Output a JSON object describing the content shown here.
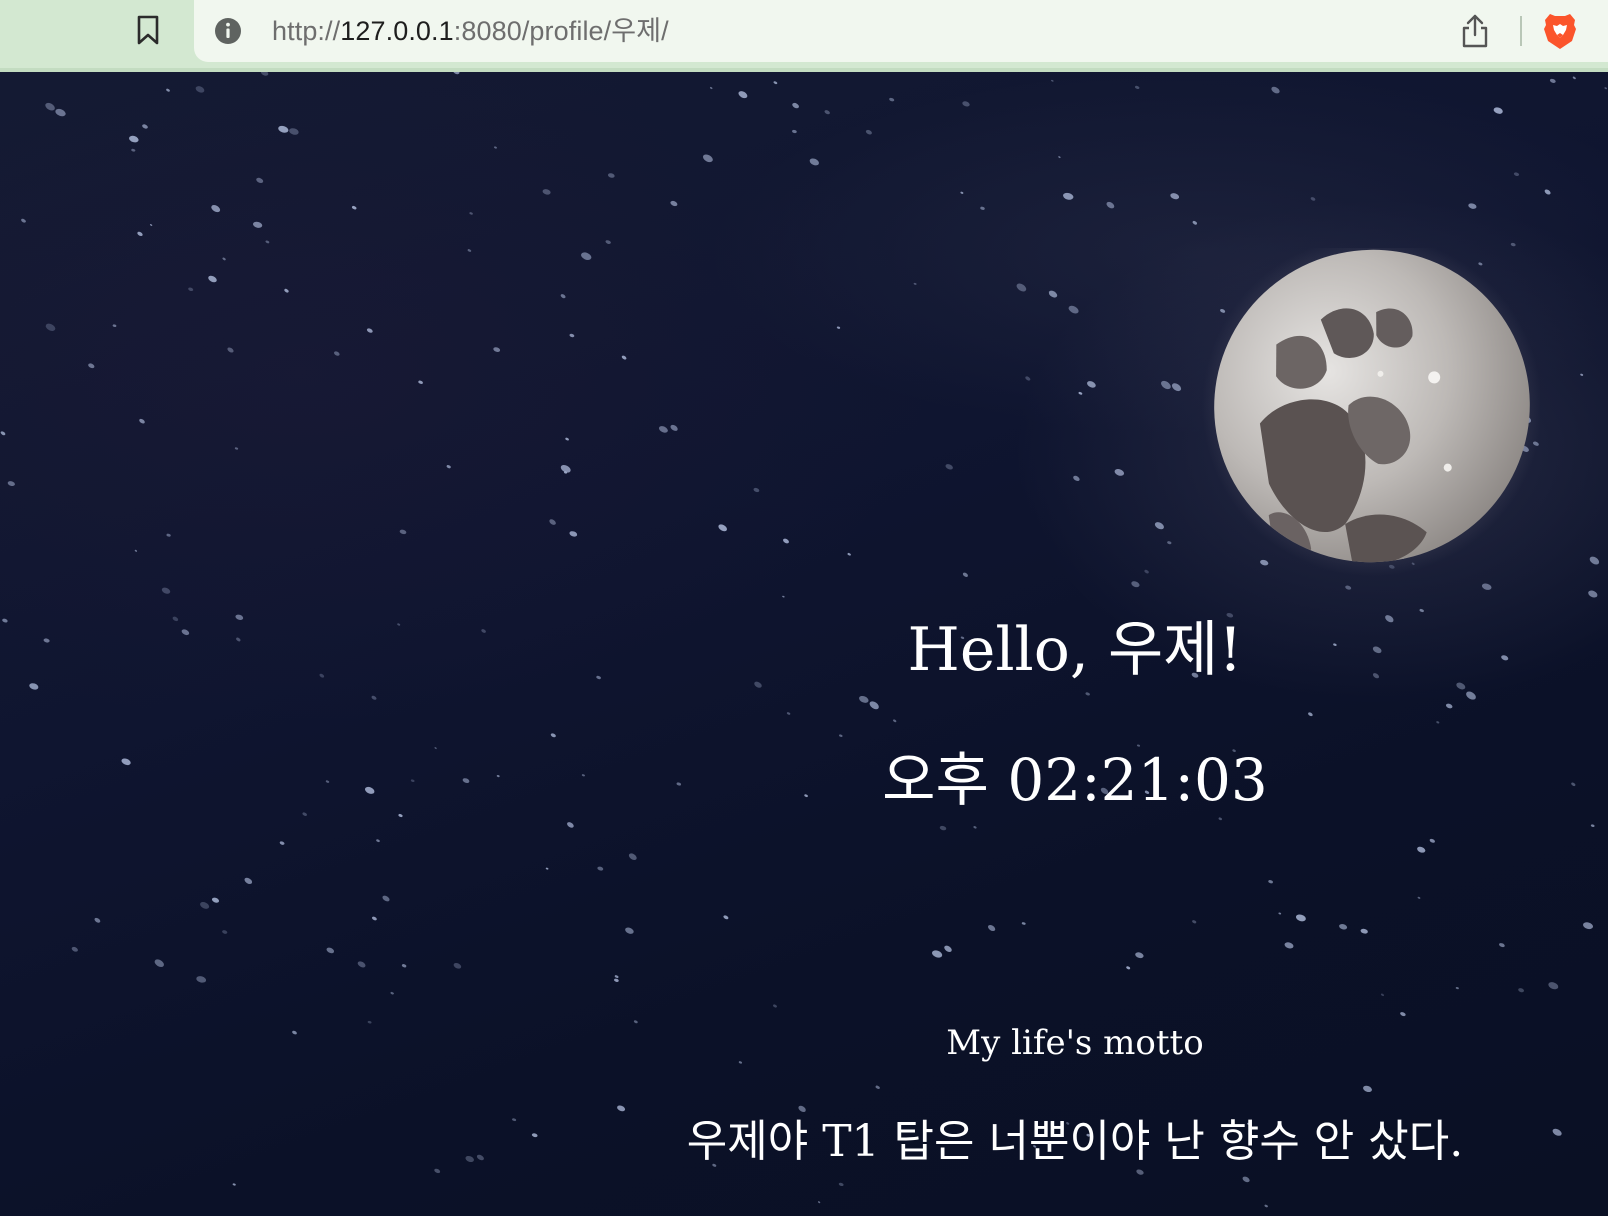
{
  "browser": {
    "url_scheme": "http://",
    "url_host": "127.0.0.1",
    "url_path": ":8080/profile/우제/",
    "icons": {
      "bookmark": "bookmark-icon",
      "info": "info-icon",
      "share": "share-icon",
      "brave": "brave-lion-icon"
    }
  },
  "profile": {
    "greeting": "Hello, 우제!",
    "clock": "오후 02:21:03",
    "motto_label": "My life's motto",
    "motto": "우제야 T1 탑은 너뿐이야 난 향수 안 샀다."
  },
  "colors": {
    "toolbar_bg": "#d3e8d1",
    "urlbar_bg": "#f1f7ef",
    "sky": "#0d1224",
    "text": "#ffffff",
    "brave_orange": "#fb542b"
  }
}
